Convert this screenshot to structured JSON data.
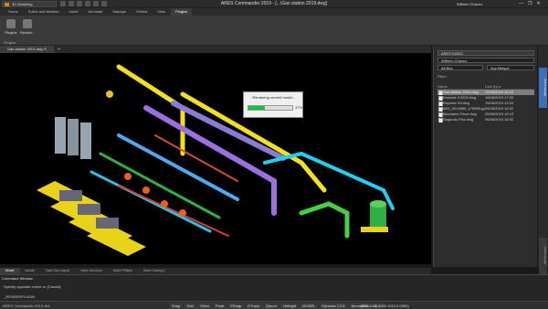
{
  "app": {
    "workspace": "3D Modeling",
    "title": "ARES Commander 2019 - [...\\Gas station 2019.dwg]",
    "user": "Wilfrem Chavez",
    "window_buttons": [
      "—",
      "❐",
      "✕"
    ]
  },
  "ribbon_tabs": [
    "Home",
    "Solids and Meshes",
    "Insert",
    "Annotate",
    "Manage",
    "Sheets",
    "View",
    "Plugins"
  ],
  "active_tab_index": 7,
  "ribbon": {
    "buttons": [
      "Plugins",
      "Render..."
    ],
    "group_label": "Plugins"
  },
  "document_tabs": [
    {
      "label": "Gas station 2019.dwg",
      "close": "✕"
    }
  ],
  "add_tab": "+",
  "progress_dialog": {
    "title": "Rendering current model...",
    "percent_label": "37%",
    "progress": 0.37
  },
  "panel": {
    "app_label": "ARES KUDO",
    "account": "Wilfrem Chavez",
    "file_filter": "All files",
    "scope_filter": "Any filetype",
    "breadcrumb": "Files ›",
    "columns": [
      "Name",
      "Last Sync"
    ],
    "files": [
      {
        "name": "Gas station 2019.dwg",
        "date": "19/06/2019 16:23"
      },
      {
        "name": "Keynote XX025.dwg",
        "date": "18/06/2019 17:53"
      },
      {
        "name": "Keynote X5.dwg",
        "date": "15/06/2019 12:24"
      },
      {
        "name": "IMG_0019656_175555.jpg",
        "date": "26/06/2019 18:02"
      },
      {
        "name": "Mechanic Piece.dwg",
        "date": "26/06/2019 18:13"
      },
      {
        "name": "Segundo Piso.dwg",
        "date": "26/06/2019 18:02"
      }
    ],
    "selected_index": 0
  },
  "side_tabs": [
    "Cloud Storage",
    "Cloud Storage"
  ],
  "layout_tabs": [
    "Model",
    "Isolate",
    "Tank Gas Layout",
    "Valve Structure",
    "Motor Phillips",
    "Valve Closing 2"
  ],
  "active_layout_index": 0,
  "command": {
    "title": "Command Window",
    "line1": "Specify opposite corner or [Cancel]:",
    "line2": "_RENDERPLUGIN"
  },
  "status": {
    "left": "ARES Commander 2019 x64",
    "items": [
      "Snap",
      "Grid",
      "Ortho",
      "Polar",
      "ESnap",
      "ETrack",
      "QInput",
      "LWeight",
      "MODEL",
      "Dynamic CCS"
    ],
    "annotation": "Annotation",
    "scale": "1:1",
    "coords": "(376.4460,1050.1510,0.0000)"
  },
  "colors": {
    "accent": "#3d6fb8",
    "progress": "#19c13d",
    "viewport_bg": "#000000"
  }
}
